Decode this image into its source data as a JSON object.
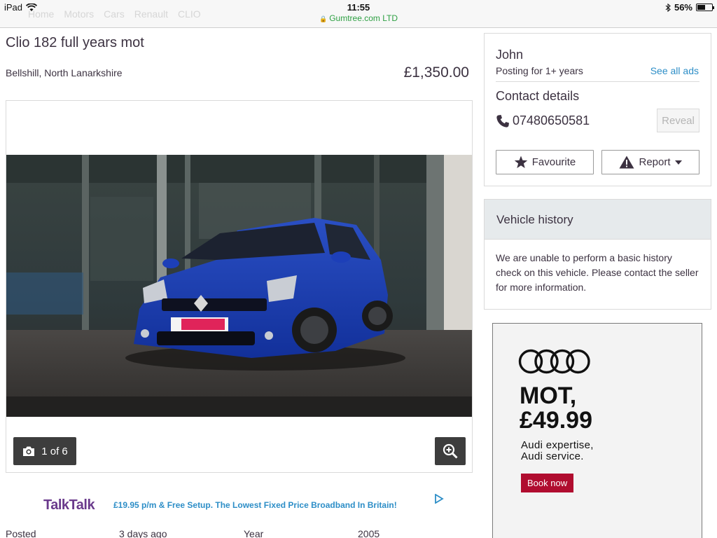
{
  "status_bar": {
    "device": "iPad",
    "time": "11:55",
    "url": "Gumtree.com LTD",
    "battery": "56%",
    "battery_level": 0.56
  },
  "breadcrumb": [
    "Home",
    "Motors",
    "Cars",
    "Renault",
    "CLIO"
  ],
  "listing": {
    "title": "Clio 182 full years mot",
    "location": "Bellshill, North Lanarkshire",
    "price": "£1,350.00",
    "photo_counter": "1 of 6"
  },
  "seller": {
    "name": "John",
    "posting_for": "Posting for 1+ years",
    "see_all": "See all ads",
    "contact_title": "Contact details",
    "phone": "07480650581",
    "reveal": "Reveal",
    "favourite": "Favourite",
    "report": "Report"
  },
  "vehicle_history": {
    "title": "Vehicle history",
    "text": "We are unable to perform a basic history check on this vehicle. Please contact the seller for more information."
  },
  "talktalk_ad": {
    "brand": "TalkTalk",
    "text": "£19.95 p/m & Free Setup. The Lowest Fixed Price Broadband In Britain!"
  },
  "audi_ad": {
    "headline_line1": "MOT,",
    "headline_line2": "£49.99",
    "sub_line1": "Audi expertise,",
    "sub_line2": "Audi service.",
    "cta": "Book now"
  },
  "attributes": [
    {
      "label": "Posted",
      "value": "3 days ago"
    },
    {
      "label": "Year",
      "value": "2005"
    }
  ],
  "colors": {
    "link": "#2d8ec7",
    "text": "#3c3241",
    "history_header": "#e6eaec",
    "audi_cta": "#b00d2f",
    "url_green": "#2ea043"
  }
}
